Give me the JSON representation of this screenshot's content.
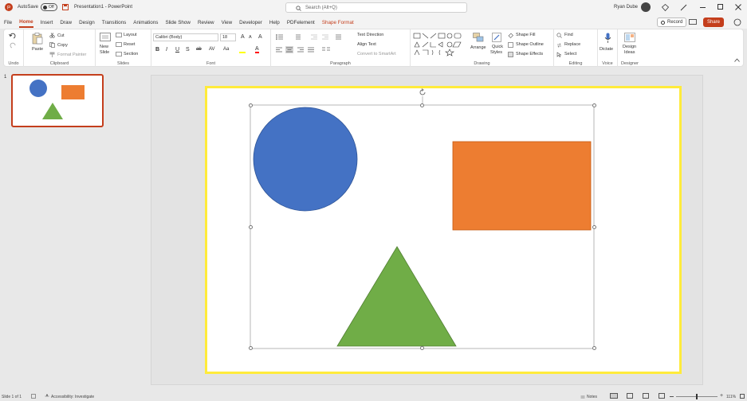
{
  "titlebar": {
    "autosave_label": "AutoSave",
    "autosave_state": "Off",
    "doc_title": "Presentation1 - PowerPoint",
    "search_placeholder": "Search (Alt+Q)",
    "user_name": "Ryan Dube"
  },
  "menubar": {
    "tabs": [
      "File",
      "Home",
      "Insert",
      "Draw",
      "Design",
      "Transitions",
      "Animations",
      "Slide Show",
      "Review",
      "View",
      "Developer",
      "Help",
      "PDFelement",
      "Shape Format"
    ],
    "record_label": "Record",
    "share_label": "Share"
  },
  "ribbon": {
    "undo": {
      "label": "Undo"
    },
    "clipboard": {
      "label": "Clipboard",
      "paste": "Paste",
      "cut": "Cut",
      "copy": "Copy",
      "format_painter": "Format Painter"
    },
    "slides": {
      "label": "Slides",
      "new_slide": "New",
      "new_slide2": "Slide",
      "layout": "Layout",
      "reset": "Reset",
      "section": "Section"
    },
    "font": {
      "label": "Font",
      "family": "Calibri (Body)",
      "size": "18"
    },
    "paragraph": {
      "label": "Paragraph",
      "text_direction": "Text Direction",
      "align_text": "Align Text",
      "smartart": "Convert to SmartArt"
    },
    "drawing": {
      "label": "Drawing",
      "arrange": "Arrange",
      "quick_styles": "Quick",
      "quick_styles2": "Styles",
      "shape_fill": "Shape Fill",
      "shape_outline": "Shape Outline",
      "shape_effects": "Shape Effects"
    },
    "editing": {
      "label": "Editing",
      "find": "Find",
      "replace": "Replace",
      "select": "Select"
    },
    "voice": {
      "label": "Voice",
      "dictate": "Dictate"
    },
    "designer": {
      "label": "Designer",
      "design_ideas": "Design",
      "design_ideas2": "Ideas"
    }
  },
  "slides_pane": {
    "slide_number": "1"
  },
  "statusbar": {
    "slide_info": "Slide 1 of 1",
    "accessibility": "Accessibility: Investigate",
    "notes": "Notes",
    "zoom": "111%"
  },
  "colors": {
    "accent": "#c43e1c",
    "circle": "#4472c4",
    "rectangle": "#ed7d31",
    "triangle": "#70ad47",
    "slide_border": "#ffeb3b"
  }
}
